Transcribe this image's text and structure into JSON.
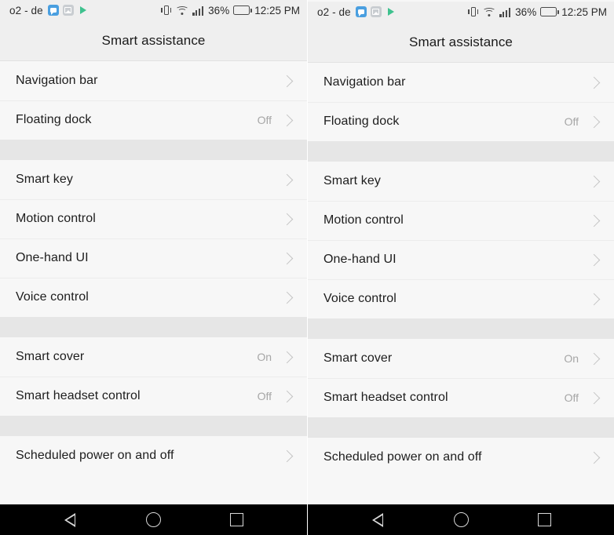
{
  "statusbar": {
    "carrier": "o2 - de",
    "notification_icons": [
      "message-icon",
      "image-icon",
      "play-icon"
    ],
    "system_icons": [
      "vibrate-icon",
      "wifi-icon",
      "signal-icon",
      "battery-icon"
    ],
    "battery_percent": "36%",
    "battery_level": 36,
    "clock": "12:25 PM"
  },
  "header": {
    "title": "Smart assistance"
  },
  "groups": [
    {
      "rows": [
        {
          "label": "Navigation bar",
          "value": ""
        },
        {
          "label": "Floating dock",
          "value": "Off"
        }
      ]
    },
    {
      "rows": [
        {
          "label": "Smart key",
          "value": ""
        },
        {
          "label": "Motion control",
          "value": ""
        },
        {
          "label": "One-hand UI",
          "value": ""
        },
        {
          "label": "Voice control",
          "value": ""
        }
      ]
    },
    {
      "rows": [
        {
          "label": "Smart cover",
          "value": "On"
        },
        {
          "label": "Smart headset control",
          "value": "Off"
        }
      ]
    },
    {
      "rows": [
        {
          "label": "Scheduled power on and off",
          "value": ""
        }
      ]
    }
  ],
  "navbar": {
    "back_label": "Back",
    "home_label": "Home",
    "recents_label": "Recents"
  },
  "colors": {
    "page_bg": "#f7f7f7",
    "header_bg": "#efefef",
    "spacer_bg": "#e6e6e6",
    "divider": "#ececec",
    "label_text": "#1d1d1d",
    "value_text": "#a6a6a6",
    "chevron": "#c4c4c4",
    "navbar_bg": "#000000",
    "navbar_icon": "#d8d8d8",
    "msg_icon": "#4a9fe0",
    "img_icon": "#c9cdd1",
    "play_icon": "#3ec18e"
  }
}
